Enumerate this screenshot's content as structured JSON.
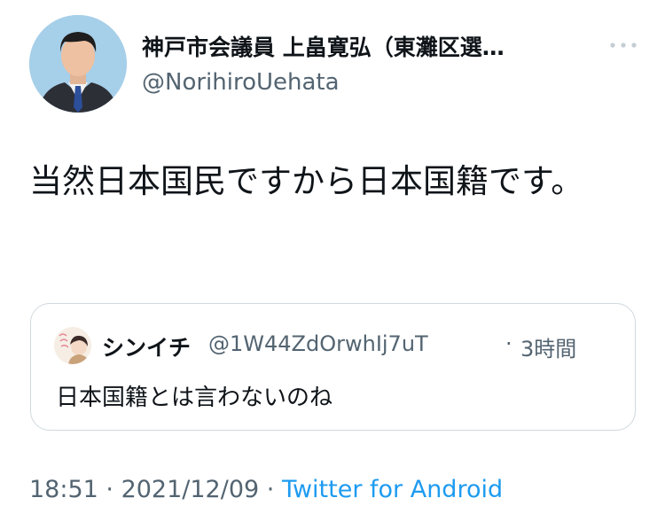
{
  "author": {
    "display_name": "神戸市会議員 上畠寛弘（東灘区選…",
    "handle": "@NorihiroUehata",
    "avatar_icon": "profile-photo-avatar"
  },
  "more_icon": "more-options-icon",
  "tweet": {
    "text": "当然日本国民ですから日本国籍です。"
  },
  "quoted_tweet": {
    "display_name": "シンイチ",
    "handle": "@1W44ZdOrwhIj7uT",
    "separator": "·",
    "time": "3時間",
    "text": "日本国籍とは言わないのね"
  },
  "footer": {
    "time": "18:51",
    "separator1": " · ",
    "date": "2021/12/09",
    "separator2": " · ",
    "source": "Twitter for Android"
  },
  "colors": {
    "text": "#0f1419",
    "secondary": "#536471",
    "link": "#1d9bf0",
    "border": "#cfd9de"
  }
}
